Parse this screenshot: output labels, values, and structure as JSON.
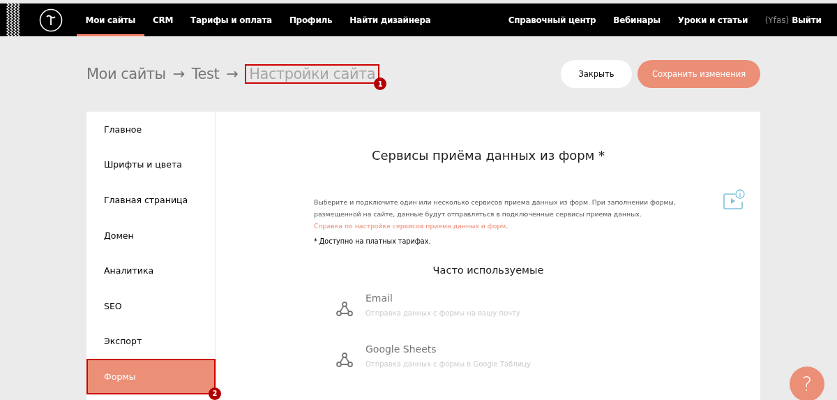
{
  "topnav": {
    "left": [
      {
        "label": "Мои сайты",
        "selected": true
      },
      {
        "label": "CRM",
        "selected": false
      },
      {
        "label": "Тарифы и оплата",
        "selected": false
      },
      {
        "label": "Профиль",
        "selected": false
      },
      {
        "label": "Найти дизайнера",
        "selected": false
      }
    ],
    "right": [
      "Справочный центр",
      "Вебинары",
      "Уроки и статьи"
    ],
    "user": "(Yfas)",
    "logout": "Выйти"
  },
  "breadcrumb": [
    {
      "label": "Мои сайты",
      "current": false
    },
    {
      "label": "Test",
      "current": false
    },
    {
      "label": "Настройки сайта",
      "current": true
    }
  ],
  "breadcrumb_separator": "→",
  "buttons": [
    {
      "label": "Закрыть",
      "kind": "secondary"
    },
    {
      "label": "Сохранить изменения",
      "kind": "primary"
    }
  ],
  "sidebar": {
    "items": [
      {
        "label": "Главное",
        "selected": false
      },
      {
        "label": "Шрифты и цвета",
        "selected": false
      },
      {
        "label": "Главная страница",
        "selected": false
      },
      {
        "label": "Домен",
        "selected": false
      },
      {
        "label": "Аналитика",
        "selected": false
      },
      {
        "label": "SEO",
        "selected": false
      },
      {
        "label": "Экспорт",
        "selected": false
      },
      {
        "label": "Формы",
        "selected": true
      }
    ]
  },
  "content": {
    "title": "Сервисы приёма данных из форм *",
    "description": "Выберите и подключите один или несколько сервисов приема данных из форм. При заполнении формы, размещенной на сайте, данные будут отправляться в подключенные сервисы приема данных.",
    "help_link": "Справка по настройке сервисов приема данных и форм",
    "help_link_end": ".",
    "note": "* Доступно на платных тарифах.",
    "section_title": "Часто используемые",
    "services": [
      {
        "name": "Email",
        "description": "Отправка данных с формы на вашу почту"
      },
      {
        "name": "Google Sheets",
        "description": "Отправка данных с формы в Google Таблицу"
      }
    ]
  },
  "annotations": [
    {
      "number": "1"
    },
    {
      "number": "2"
    }
  ],
  "help_button": "?"
}
